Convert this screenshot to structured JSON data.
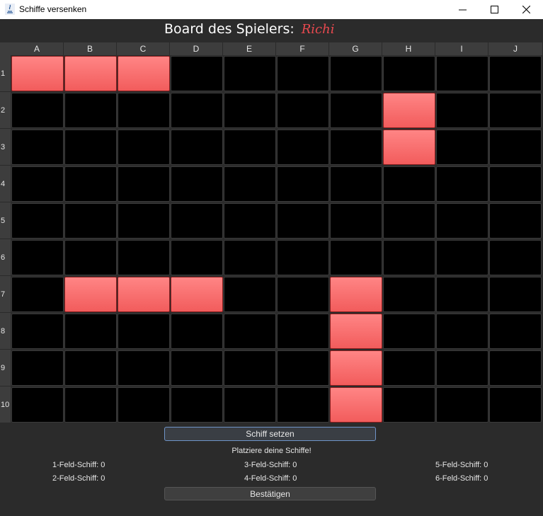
{
  "window": {
    "title": "Schiffe versenken"
  },
  "board": {
    "label": "Board des Spielers:",
    "player": "Richi"
  },
  "columns": [
    "A",
    "B",
    "C",
    "D",
    "E",
    "F",
    "G",
    "H",
    "I",
    "J"
  ],
  "rows": [
    "1",
    "2",
    "3",
    "4",
    "5",
    "6",
    "7",
    "8",
    "9",
    "10"
  ],
  "ships": [
    [
      0,
      0
    ],
    [
      0,
      1
    ],
    [
      0,
      2
    ],
    [
      1,
      7
    ],
    [
      2,
      7
    ],
    [
      6,
      1
    ],
    [
      6,
      2
    ],
    [
      6,
      3
    ],
    [
      6,
      6
    ],
    [
      7,
      6
    ],
    [
      8,
      6
    ],
    [
      9,
      6
    ]
  ],
  "controls": {
    "set_ship": "Schiff setzen",
    "status": "Platziere deine Schiffe!",
    "confirm": "Bestätigen"
  },
  "counts": [
    {
      "label": "1-Feld-Schiff: 0"
    },
    {
      "label": "3-Feld-Schiff: 0"
    },
    {
      "label": "5-Feld-Schiff: 0"
    },
    {
      "label": "2-Feld-Schiff: 0"
    },
    {
      "label": "4-Feld-Schiff: 0"
    },
    {
      "label": "6-Feld-Schiff: 0"
    }
  ],
  "colors": {
    "ship": "#f26b6b",
    "empty": "#000000",
    "player_name": "#e8494f",
    "accent_border": "#6f94c8"
  }
}
